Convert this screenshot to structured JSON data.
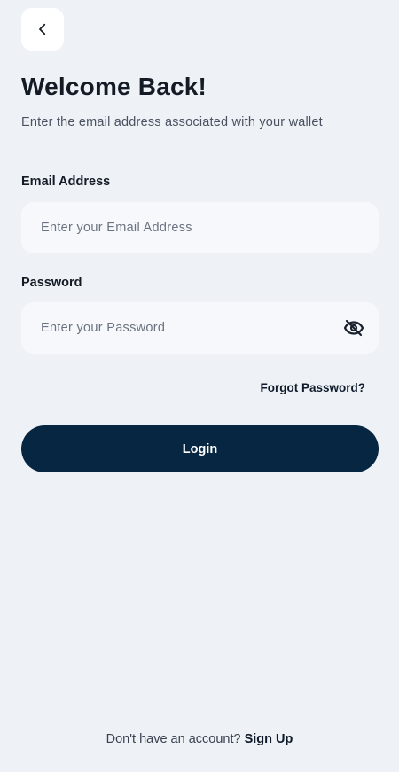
{
  "header": {
    "back_icon": "chevron-left-icon",
    "title": "Welcome Back!",
    "subtitle": "Enter the email address associated with your wallet"
  },
  "form": {
    "email": {
      "label": "Email Address",
      "value": "",
      "placeholder": "Enter your Email Address"
    },
    "password": {
      "label": "Password",
      "value": "",
      "placeholder": "Enter your Password",
      "toggle_icon": "eye-off-icon"
    },
    "forgot_label": "Forgot Password?",
    "login_label": "Login"
  },
  "footer": {
    "prompt": "Don't have an account?",
    "signup_label": "Sign Up"
  },
  "colors": {
    "background": "#eef2f7",
    "field_background": "#f6f8fc",
    "primary": "#072641",
    "text": "#141b24"
  }
}
